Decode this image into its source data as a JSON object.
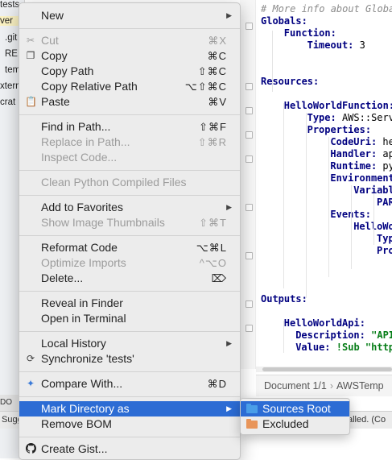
{
  "project_panel": {
    "rows": [
      "tests",
      "ver",
      ".git",
      "RE",
      "tem",
      "xtern",
      "crat"
    ],
    "bottom_label": "DO"
  },
  "editor": {
    "lines": [
      {
        "text": "# More info about Globa",
        "kind": "comment",
        "indent": 0
      },
      {
        "text": "Globals:",
        "kind": "key",
        "indent": 0
      },
      {
        "text": "Function:",
        "kind": "key",
        "indent": 2
      },
      {
        "key": "Timeout:",
        "value": " 3",
        "indent": 4
      },
      {
        "text": "Resources:",
        "kind": "key",
        "indent": 0
      },
      {
        "text": "HelloWorldFunction:",
        "kind": "key",
        "indent": 2
      },
      {
        "key": "Type:",
        "value": " AWS::Serve",
        "indent": 4
      },
      {
        "text": "Properties:",
        "kind": "key",
        "indent": 4
      },
      {
        "key": "CodeUri:",
        "value": " he",
        "indent": 6
      },
      {
        "key": "Handler:",
        "value": " app",
        "indent": 6
      },
      {
        "key": "Runtime:",
        "value": " pyt",
        "indent": 6
      },
      {
        "text": "Environment",
        "kind": "key",
        "indent": 6
      },
      {
        "text": "Variabl",
        "kind": "key",
        "indent": 8
      },
      {
        "text": "PARA",
        "kind": "key",
        "indent": 10
      },
      {
        "text": "Events:",
        "kind": "key",
        "indent": 6
      },
      {
        "text": "HelloWor",
        "kind": "key",
        "indent": 8
      },
      {
        "text": "Type",
        "kind": "key",
        "indent": 10
      },
      {
        "text": "Prop",
        "kind": "key",
        "indent": 10
      },
      {
        "text": "Outputs:",
        "kind": "key",
        "indent": 0
      },
      {
        "text": "HelloWorldApi:",
        "kind": "key",
        "indent": 2
      },
      {
        "key": "Description:",
        "value": " \"API",
        "indent": 3,
        "string": true
      },
      {
        "key": "Value:",
        "value": " !Sub \"https",
        "indent": 3,
        "string": true
      }
    ],
    "breadcrumb": [
      "Document 1/1",
      "AWSTemp"
    ]
  },
  "status_bar": {
    "left": "Sugg",
    "right": "alled. (Co"
  },
  "context_menu": {
    "new": "New",
    "cut": {
      "label": "Cut",
      "shortcut": "⌘X"
    },
    "copy": {
      "label": "Copy",
      "shortcut": "⌘C"
    },
    "copy_path": {
      "label": "Copy Path",
      "shortcut": "⇧⌘C"
    },
    "copy_relative_path": {
      "label": "Copy Relative Path",
      "shortcut": "⌥⇧⌘C"
    },
    "paste": {
      "label": "Paste",
      "shortcut": "⌘V"
    },
    "find_in_path": {
      "label": "Find in Path...",
      "shortcut": "⇧⌘F"
    },
    "replace_in_path": {
      "label": "Replace in Path...",
      "shortcut": "⇧⌘R"
    },
    "inspect_code": {
      "label": "Inspect Code..."
    },
    "clean_python": {
      "label": "Clean Python Compiled Files"
    },
    "add_to_favorites": {
      "label": "Add to Favorites"
    },
    "show_thumbnails": {
      "label": "Show Image Thumbnails",
      "shortcut": "⇧⌘T"
    },
    "reformat_code": {
      "label": "Reformat Code",
      "shortcut": "⌥⌘L"
    },
    "optimize_imports": {
      "label": "Optimize Imports",
      "shortcut": "^⌥O"
    },
    "delete": {
      "label": "Delete...",
      "shortcut": "⌦"
    },
    "reveal_in_finder": {
      "label": "Reveal in Finder"
    },
    "open_in_terminal": {
      "label": "Open in Terminal"
    },
    "local_history": {
      "label": "Local History"
    },
    "synchronize": {
      "label": "Synchronize 'tests'"
    },
    "compare_with": {
      "label": "Compare With...",
      "shortcut": "⌘D"
    },
    "mark_directory_as": {
      "label": "Mark Directory as"
    },
    "remove_bom": {
      "label": "Remove BOM"
    },
    "create_gist": {
      "label": "Create Gist..."
    }
  },
  "submenu": {
    "sources_root": "Sources Root",
    "excluded": "Excluded"
  },
  "colors": {
    "selection": "#2c6cd4",
    "sources_root_folder": "#4a9ee8",
    "excluded_folder": "#e8955a"
  }
}
